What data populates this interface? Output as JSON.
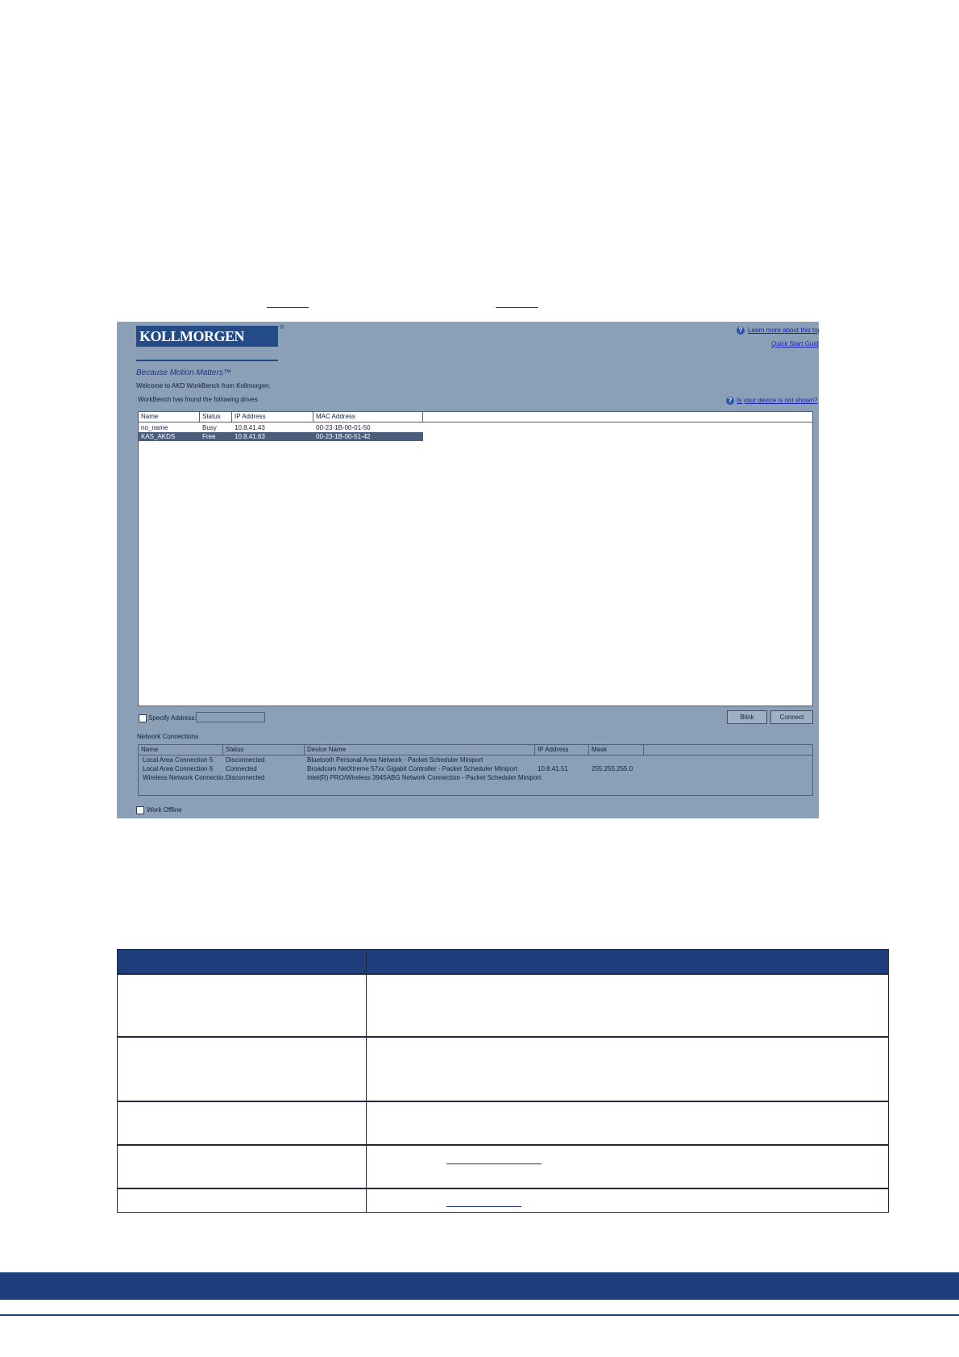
{
  "screenshot": {
    "logo_text": "KOLLMORGEN",
    "logo_reg": "®",
    "tagline": "Because Motion Matters™",
    "welcome": "Welcome to AKD WorkBench from Kollmorgen.",
    "found_text": "WorkBench has found the following drives",
    "help_icon": "?",
    "learn_more_link": "Learn more about this topic",
    "quick_start_link": "Quick Start Guide",
    "device_not_shown_link": "Is your device is not shown?",
    "drives": {
      "columns": [
        "Name",
        "Status",
        "IP Address",
        "MAC Address"
      ],
      "rows": [
        {
          "name": "no_name",
          "status": "Busy",
          "ip": "10.8.41.43",
          "mac": "00-23-1B-00-01-50",
          "selected": false
        },
        {
          "name": "KAS_AKDS",
          "status": "Free",
          "ip": "10.8.41.63",
          "mac": "00-23-1B-00-51-42",
          "selected": true
        }
      ]
    },
    "specify_address_label": "Specify Address:",
    "specify_address_value": "",
    "blink_button": "Blink",
    "connect_button": "Connect",
    "network_connections_label": "Network Connections",
    "networks": {
      "columns": [
        "Name",
        "Status",
        "Device Name",
        "IP Address",
        "Mask"
      ],
      "rows": [
        {
          "name": "Local Area Connection 5",
          "status": "Disconnected",
          "device": "Bluetooth Personal Area Network - Packet Scheduler Miniport",
          "ip": "",
          "mask": ""
        },
        {
          "name": "Local Area Connection 6",
          "status": "Connected",
          "device": "Broadcom NetXtreme 57xx Gigabit Controller - Packet Scheduler Miniport",
          "ip": "10.8.41.51",
          "mask": "255.255.255.0"
        },
        {
          "name": "Wireless Network Connectio...",
          "status": "Disconnected",
          "device": "Intel(R) PRO/Wireless 3945ABG Network Connection - Packet Scheduler Miniport",
          "ip": "",
          "mask": ""
        }
      ]
    },
    "work_offline_label": "Work Offline"
  }
}
